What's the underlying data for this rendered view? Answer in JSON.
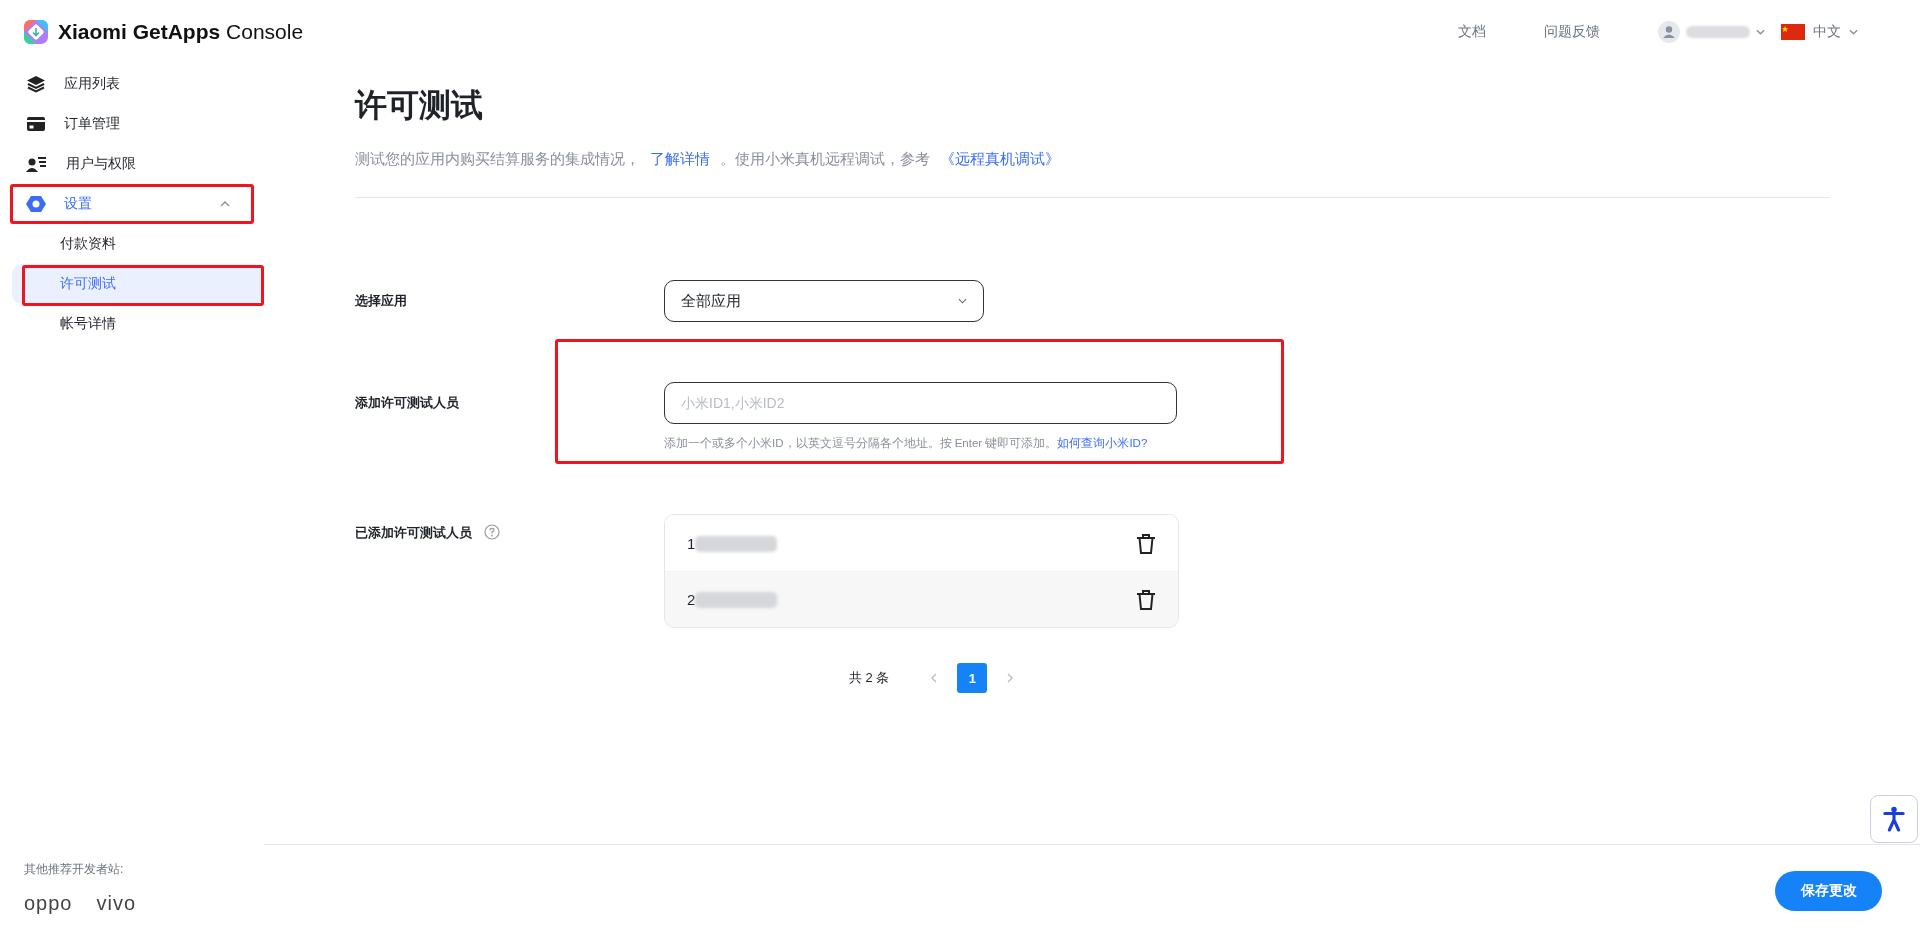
{
  "header": {
    "logo_name": "Xiaomi GetApps",
    "logo_suffix": "Console",
    "links": [
      "文档",
      "问题反馈"
    ],
    "language": "中文"
  },
  "sidebar": {
    "items": [
      {
        "label": "应用列表",
        "selected": false,
        "highlighted": false
      },
      {
        "label": "订单管理",
        "selected": false,
        "highlighted": false
      },
      {
        "label": "用户与权限",
        "selected": false,
        "highlighted": false
      },
      {
        "label": "设置",
        "selected": true,
        "expanded": true,
        "highlighted": true,
        "children": [
          {
            "label": "付款资料",
            "selected": false,
            "highlighted": false
          },
          {
            "label": "许可测试",
            "selected": true,
            "highlighted": true
          },
          {
            "label": "帐号详情",
            "selected": false,
            "highlighted": false
          }
        ]
      }
    ]
  },
  "page": {
    "title": "许可测试",
    "description": [
      {
        "kind": "text",
        "text": "测试您的应用内购买结算服务的集成情况，"
      },
      {
        "kind": "link",
        "text": "了解详情"
      },
      {
        "kind": "text",
        "text": "。使用小米真机远程调试，参考"
      },
      {
        "kind": "link",
        "text": "《远程真机调试》"
      }
    ]
  },
  "form": {
    "app_select": {
      "label": "选择应用",
      "value": "全部应用"
    },
    "testers_input": {
      "label": "添加许可测试人员",
      "placeholder": "小米ID1,小米ID2",
      "hint": "添加一个或多个小米ID，以英文逗号分隔各个地址。按 Enter 键即可添加。",
      "hint_link": "如何查询小米ID?",
      "highlighted": true
    },
    "testers_list": {
      "label": "已添加许可测试人员",
      "rows": [
        {
          "id": "1"
        },
        {
          "id": "2"
        }
      ]
    },
    "pagination": {
      "total": "共 2 条",
      "pages": [
        {
          "label": "1",
          "selected": true
        }
      ]
    }
  },
  "footer": {
    "partners_label": "其他推荐开发者站:",
    "partners": [
      "oppo",
      "vivo"
    ],
    "save_button": "保存更改"
  }
}
